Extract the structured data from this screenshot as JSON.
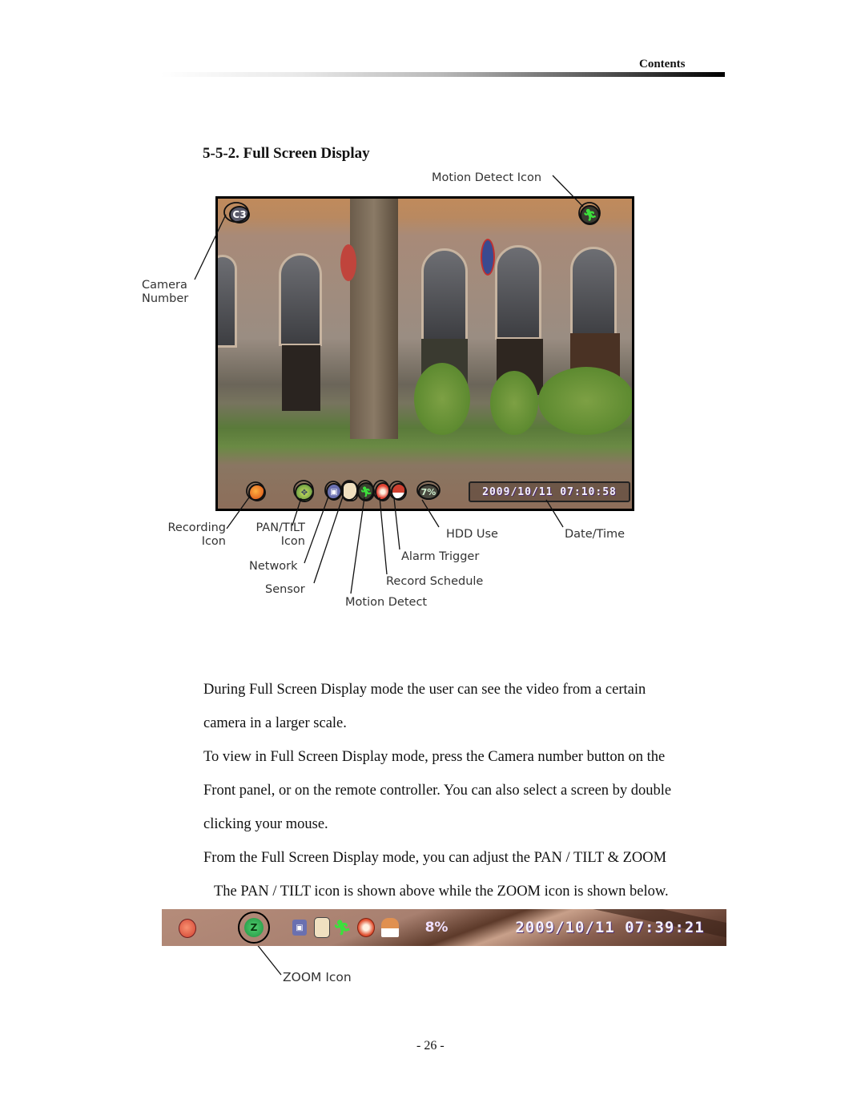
{
  "header": {
    "section_label": "Contents"
  },
  "section": {
    "title": "5-5-2. Full Screen Display"
  },
  "figure1": {
    "osd": {
      "camera_number": "C3",
      "hdd_use": "7%",
      "datetime": "2009/10/11  07:10:58"
    },
    "callouts": {
      "motion_detect_icon": "Motion Detect Icon",
      "camera_number_line1": "Camera",
      "camera_number_line2": "Number",
      "recording_line1": "Recording",
      "recording_line2": "Icon",
      "pantilt_line1": "PAN/TILT",
      "pantilt_line2": "Icon",
      "network": "Network",
      "sensor": "Sensor",
      "motion_detect": "Motion Detect",
      "record_schedule": "Record Schedule",
      "alarm_trigger": "Alarm Trigger",
      "hdd_use": "HDD Use",
      "date_time": "Date/Time"
    },
    "icons": [
      "recording-icon",
      "pan-tilt-icon",
      "network-icon",
      "sensor-icon",
      "motion-detect-icon",
      "record-schedule-icon",
      "alarm-trigger-icon",
      "hdd-use-indicator",
      "date-time-display"
    ]
  },
  "body": {
    "p1_line1": "During Full Screen Display mode the user can see the video from a certain",
    "p1_line2": "camera in a larger scale.",
    "p2_line1": "To view in Full Screen Display mode, press the Camera number button on the",
    "p2_line2": "Front panel, or on the remote controller. You can also select a screen by double",
    "p2_line3": "clicking your mouse.",
    "p3_line1": "From the Full Screen Display mode, you can adjust the PAN / TILT & ZOOM",
    "p3_line2": "The PAN / TILT icon is shown above while the ZOOM icon is shown below."
  },
  "figure2": {
    "osd": {
      "zoom_glyph": "Z",
      "hdd_use": "8%",
      "datetime": "2009/10/11  07:39:21"
    },
    "callouts": {
      "zoom_icon": "ZOOM Icon"
    }
  },
  "footer": {
    "page_number": "- 26 -"
  }
}
